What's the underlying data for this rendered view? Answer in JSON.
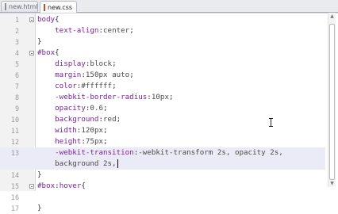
{
  "tabs": [
    {
      "label": "new.html",
      "active": false
    },
    {
      "label": "new.css",
      "active": true
    }
  ],
  "lines": [
    {
      "num": "1",
      "fold": true,
      "highlight": false,
      "tokens": [
        [
          "sel",
          "body"
        ],
        [
          "punc",
          "{"
        ]
      ]
    },
    {
      "num": "2",
      "fold": false,
      "highlight": false,
      "tokens": [
        [
          "prop",
          "    text-align"
        ],
        [
          "punc",
          ":"
        ],
        [
          "val",
          "center"
        ],
        [
          "punc",
          ";"
        ]
      ]
    },
    {
      "num": "3",
      "fold": false,
      "highlight": false,
      "tokens": [
        [
          "punc",
          "}"
        ]
      ]
    },
    {
      "num": "4",
      "fold": true,
      "highlight": false,
      "tokens": [
        [
          "sel",
          "#box"
        ],
        [
          "punc",
          "{"
        ]
      ]
    },
    {
      "num": "5",
      "fold": false,
      "highlight": false,
      "tokens": [
        [
          "prop",
          "    display"
        ],
        [
          "punc",
          ":"
        ],
        [
          "val",
          "block"
        ],
        [
          "punc",
          ";"
        ]
      ]
    },
    {
      "num": "6",
      "fold": false,
      "highlight": false,
      "tokens": [
        [
          "prop",
          "    margin"
        ],
        [
          "punc",
          ":"
        ],
        [
          "val",
          "150px auto"
        ],
        [
          "punc",
          ";"
        ]
      ]
    },
    {
      "num": "7",
      "fold": false,
      "highlight": false,
      "tokens": [
        [
          "prop",
          "    color"
        ],
        [
          "punc",
          ":"
        ],
        [
          "val",
          "#ffffff"
        ],
        [
          "punc",
          ";"
        ]
      ]
    },
    {
      "num": "8",
      "fold": false,
      "highlight": false,
      "tokens": [
        [
          "prop",
          "    -webkit-border-radius"
        ],
        [
          "punc",
          ":"
        ],
        [
          "val",
          "10px"
        ],
        [
          "punc",
          ";"
        ]
      ]
    },
    {
      "num": "9",
      "fold": false,
      "highlight": false,
      "tokens": [
        [
          "prop",
          "    opacity"
        ],
        [
          "punc",
          ":"
        ],
        [
          "val",
          "0.6"
        ],
        [
          "punc",
          ";"
        ]
      ]
    },
    {
      "num": "10",
      "fold": false,
      "highlight": false,
      "tokens": [
        [
          "prop",
          "    background"
        ],
        [
          "punc",
          ":"
        ],
        [
          "val",
          "red"
        ],
        [
          "punc",
          ";"
        ]
      ]
    },
    {
      "num": "11",
      "fold": false,
      "highlight": false,
      "tokens": [
        [
          "prop",
          "    width"
        ],
        [
          "punc",
          ":"
        ],
        [
          "val",
          "120px"
        ],
        [
          "punc",
          ";"
        ]
      ]
    },
    {
      "num": "12",
      "fold": false,
      "highlight": false,
      "tokens": [
        [
          "prop",
          "    height"
        ],
        [
          "punc",
          ":"
        ],
        [
          "val",
          "75px"
        ],
        [
          "punc",
          ";"
        ]
      ]
    },
    {
      "num": "13",
      "fold": false,
      "highlight": true,
      "tokens": [
        [
          "prop",
          "    -webkit-transition"
        ],
        [
          "punc",
          ":"
        ],
        [
          "val",
          "-webkit-transform 2s, opacity 2s,"
        ]
      ]
    },
    {
      "num": "",
      "fold": false,
      "highlight": true,
      "cursor": true,
      "tokens": [
        [
          "val",
          "    background 2s,"
        ]
      ]
    },
    {
      "num": "14",
      "fold": false,
      "highlight": false,
      "tokens": [
        [
          "punc",
          "}"
        ]
      ]
    },
    {
      "num": "15",
      "fold": true,
      "highlight": false,
      "tokens": [
        [
          "sel",
          "#box"
        ],
        [
          "punc",
          ":"
        ],
        [
          "sel",
          "hover"
        ],
        [
          "punc",
          "{"
        ]
      ]
    },
    {
      "num": "16",
      "fold": false,
      "highlight": false,
      "tokens": []
    },
    {
      "num": "17",
      "fold": false,
      "highlight": false,
      "tokens": [
        [
          "punc",
          "}"
        ]
      ]
    }
  ]
}
